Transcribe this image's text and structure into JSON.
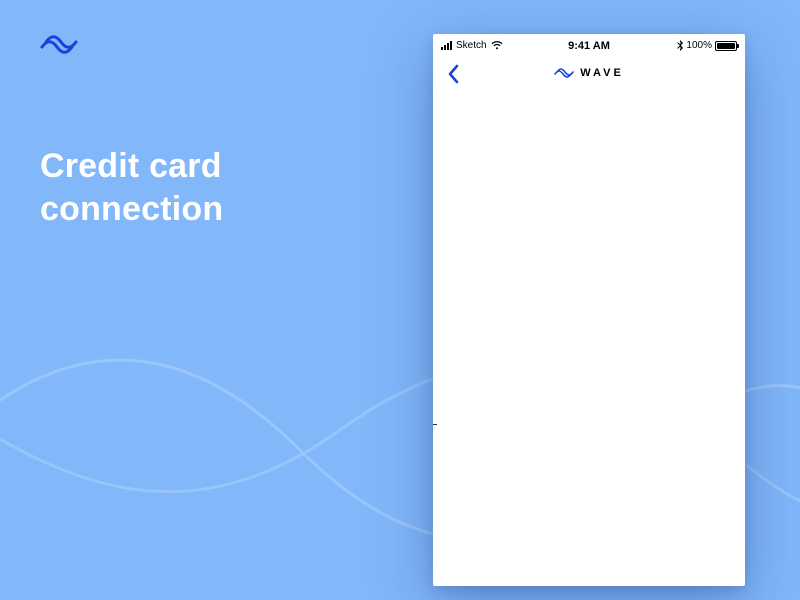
{
  "presentation": {
    "headline_line1": "Credit card",
    "headline_line2": "connection"
  },
  "statusbar": {
    "carrier": "Sketch",
    "time": "9:41 AM",
    "battery_pct": "100%"
  },
  "navbar": {
    "brand": "WAVE"
  },
  "colors": {
    "background": "#82B7FA",
    "accent": "#1E40D8",
    "wave_stroke": "#9AC6FB"
  }
}
